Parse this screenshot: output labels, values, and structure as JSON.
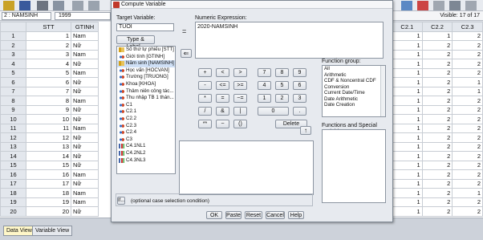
{
  "cellbar": {
    "ref": "2 : NAMSINH",
    "value": "1999",
    "visible": "Visible: 17 of 17"
  },
  "grid_left": {
    "headers": [
      "STT",
      "GTINH"
    ],
    "rows": [
      {
        "n": "1",
        "stt": "1",
        "gt": "Nam"
      },
      {
        "n": "2",
        "stt": "2",
        "gt": "Nữ"
      },
      {
        "n": "3",
        "stt": "3",
        "gt": "Nam"
      },
      {
        "n": "4",
        "stt": "4",
        "gt": "Nữ"
      },
      {
        "n": "5",
        "stt": "5",
        "gt": "Nam"
      },
      {
        "n": "6",
        "stt": "6",
        "gt": "Nữ"
      },
      {
        "n": "7",
        "stt": "7",
        "gt": "Nữ"
      },
      {
        "n": "8",
        "stt": "8",
        "gt": "Nam"
      },
      {
        "n": "9",
        "stt": "9",
        "gt": "Nữ"
      },
      {
        "n": "10",
        "stt": "10",
        "gt": "Nữ"
      },
      {
        "n": "11",
        "stt": "11",
        "gt": "Nam"
      },
      {
        "n": "12",
        "stt": "12",
        "gt": "Nữ"
      },
      {
        "n": "13",
        "stt": "13",
        "gt": "Nữ"
      },
      {
        "n": "14",
        "stt": "14",
        "gt": "Nữ"
      },
      {
        "n": "15",
        "stt": "15",
        "gt": "Nữ"
      },
      {
        "n": "16",
        "stt": "16",
        "gt": "Nam"
      },
      {
        "n": "17",
        "stt": "17",
        "gt": "Nữ"
      },
      {
        "n": "18",
        "stt": "18",
        "gt": "Nam"
      },
      {
        "n": "19",
        "stt": "19",
        "gt": "Nam"
      },
      {
        "n": "20",
        "stt": "20",
        "gt": "Nữ"
      }
    ]
  },
  "grid_right": {
    "headers": [
      "C2.1",
      "C2.2",
      "C2.3"
    ],
    "rows": [
      [
        "1",
        "1",
        "2"
      ],
      [
        "1",
        "2",
        "2"
      ],
      [
        "1",
        "2",
        "2"
      ],
      [
        "1",
        "2",
        "2"
      ],
      [
        "1",
        "2",
        "2"
      ],
      [
        "1",
        "2",
        "1"
      ],
      [
        "1",
        "2",
        "1"
      ],
      [
        "1",
        "2",
        "2"
      ],
      [
        "1",
        "2",
        "2"
      ],
      [
        "1",
        "2",
        "2"
      ],
      [
        "1",
        "2",
        "2"
      ],
      [
        "1",
        "2",
        "2"
      ],
      [
        "1",
        "2",
        "2"
      ],
      [
        "1",
        "2",
        "2"
      ],
      [
        "1",
        "2",
        "2"
      ],
      [
        "1",
        "2",
        "2"
      ],
      [
        "1",
        "2",
        "2"
      ],
      [
        "1",
        "2",
        "1"
      ],
      [
        "1",
        "2",
        "2"
      ],
      [
        "1",
        "2",
        "2"
      ]
    ]
  },
  "tabs": {
    "data_view": "Data View",
    "variable_view": "Variable View"
  },
  "dialog": {
    "title": "Compute Variable",
    "target_label": "Target Variable:",
    "target_value": "TUOI",
    "equals": "=",
    "expr_label": "Numeric Expression:",
    "expr_value": "2020-NAMSINH",
    "type_label_btn": "Type & Label...",
    "arrow": "⇐",
    "variables": [
      {
        "label": "Số thứ tự phiếu [STT]",
        "icon": "ruler"
      },
      {
        "label": "Giới tính [GTINH]",
        "icon": "nominal"
      },
      {
        "label": "Năm sinh [NAMSINH]",
        "icon": "ruler",
        "selected": true
      },
      {
        "label": "Học vấn [HOCVAN]",
        "icon": "nominal"
      },
      {
        "label": "Trường [TRUONG]",
        "icon": "nominal"
      },
      {
        "label": "Khoa [KHOA]",
        "icon": "nominal"
      },
      {
        "label": "Thâm niên công tác...",
        "icon": "nominal"
      },
      {
        "label": "Thu nhập TB 1 thán...",
        "icon": "nominal"
      },
      {
        "label": "C1",
        "icon": "nominal"
      },
      {
        "label": "C2.1",
        "icon": "nominal"
      },
      {
        "label": "C2.2",
        "icon": "nominal"
      },
      {
        "label": "C2.3",
        "icon": "nominal"
      },
      {
        "label": "C2.4",
        "icon": "nominal"
      },
      {
        "label": "C3",
        "icon": "nominal"
      },
      {
        "label": "C4.1NL1",
        "icon": "bar"
      },
      {
        "label": "C4.2NL2",
        "icon": "bar"
      },
      {
        "label": "C4.3NL3",
        "icon": "bar"
      }
    ],
    "keys": [
      [
        "+",
        "<",
        ">",
        "7",
        "8",
        "9"
      ],
      [
        "-",
        "<=",
        ">=",
        "4",
        "5",
        "6"
      ],
      [
        "*",
        "=",
        "~=",
        "1",
        "2",
        "3"
      ],
      [
        "/",
        "&",
        "|",
        "0",
        "."
      ],
      [
        "**",
        "~",
        "()"
      ]
    ],
    "delete": "Delete",
    "up": "↑",
    "function_group_label": "Function group:",
    "function_groups": [
      "All",
      "Arithmetic",
      "CDF & Noncentral CDF",
      "Conversion",
      "Current Date/Time",
      "Date Arithmetic",
      "Date Creation"
    ],
    "functions_label": "Functions and Special Variables:",
    "if_btn": "If...",
    "condition_text": "(optional case selection condition)",
    "buttons": [
      "OK",
      "Paste",
      "Reset",
      "Cancel",
      "Help"
    ]
  }
}
